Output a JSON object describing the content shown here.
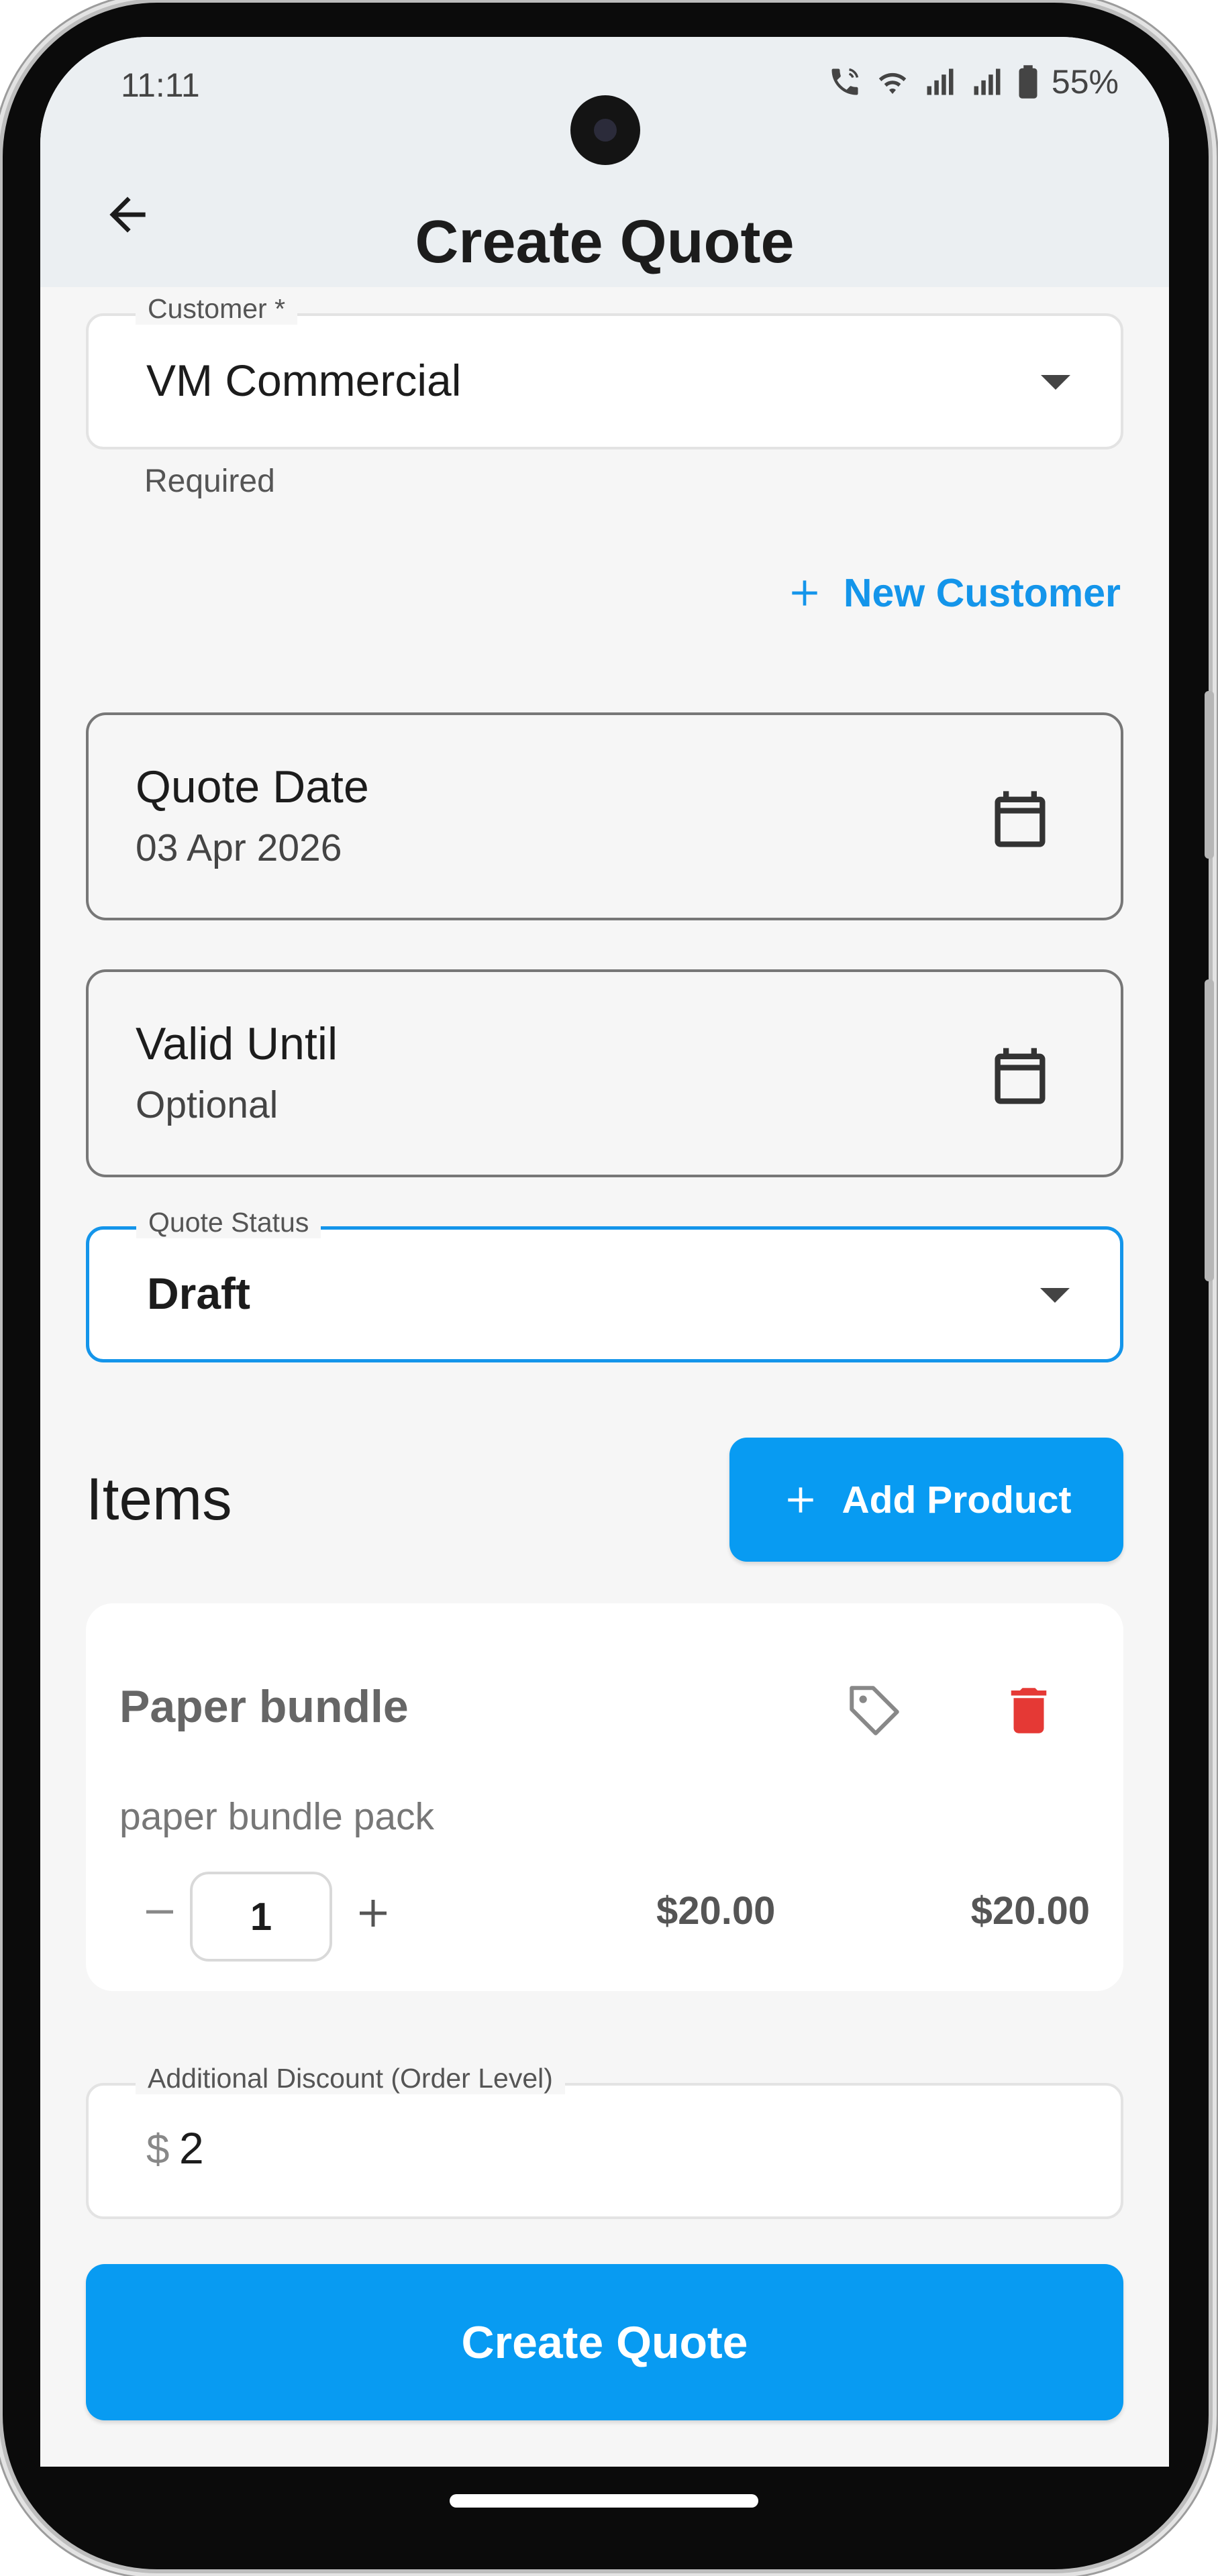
{
  "status_bar": {
    "time": "11:11",
    "battery": "55%"
  },
  "header": {
    "title": "Create Quote"
  },
  "form": {
    "customer": {
      "label": "Customer *",
      "value": "VM Commercial",
      "helper": "Required"
    },
    "new_customer_label": "New Customer",
    "quote_date": {
      "label": "Quote Date",
      "value": "03 Apr 2026"
    },
    "valid_until": {
      "label": "Valid Until",
      "value": "Optional"
    },
    "quote_status": {
      "label": "Quote Status",
      "value": "Draft"
    }
  },
  "items": {
    "title": "Items",
    "add_product_label": "Add Product",
    "list": [
      {
        "name": "Paper bundle",
        "description": "paper bundle pack",
        "quantity": "1",
        "unit_price": "$20.00",
        "total": "$20.00"
      }
    ]
  },
  "discount": {
    "label": "Additional Discount (Order Level)",
    "prefix": "$",
    "value": "2"
  },
  "submit_label": "Create Quote",
  "colors": {
    "accent": "#089bf2",
    "link": "#1495ea",
    "danger": "#e53935",
    "header_bg": "#ebeff2",
    "page_bg": "#f6f6f6"
  }
}
